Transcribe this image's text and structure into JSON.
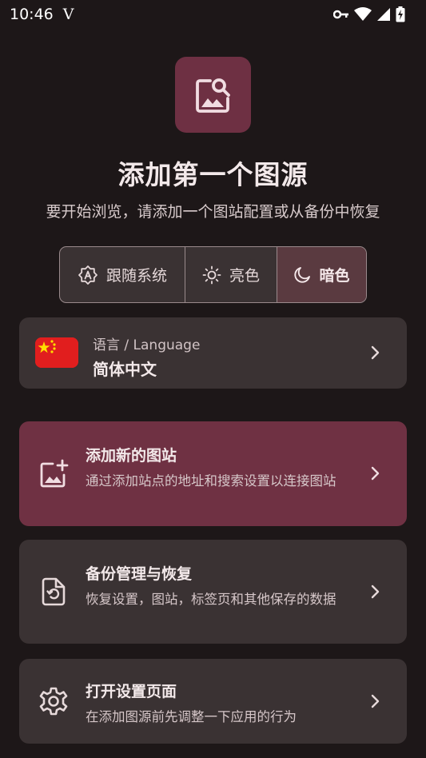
{
  "status_bar": {
    "time": "10:46",
    "notification_glyph": "V",
    "icons": [
      "vpn-key-icon",
      "wifi-icon",
      "signal-icon",
      "battery-charging-icon"
    ]
  },
  "header": {
    "icon": "image-search-icon",
    "title": "添加第一个图源",
    "subtitle": "要开始浏览，请添加一个图站配置或从备份中恢复"
  },
  "theme_selector": {
    "options": [
      {
        "label": "跟随系统",
        "icon": "auto-theme-icon",
        "selected": false
      },
      {
        "label": "亮色",
        "icon": "sun-icon",
        "selected": false
      },
      {
        "label": "暗色",
        "icon": "moon-icon",
        "selected": true
      }
    ]
  },
  "language": {
    "label": "语言 / Language",
    "value": "简体中文",
    "flag": "china-flag-icon"
  },
  "actions": [
    {
      "title": "添加新的图站",
      "description": "通过添加站点的地址和搜索设置以连接图站",
      "icon": "add-photo-icon"
    },
    {
      "title": "备份管理与恢复",
      "description": "恢复设置，图站，标签页和其他保存的数据",
      "icon": "restore-file-icon"
    },
    {
      "title": "打开设置页面",
      "description": "在添加图源前先调整一下应用的行为",
      "icon": "gear-icon"
    }
  ],
  "colors": {
    "background": "#1d1718",
    "accent": "#6f3143",
    "card": "#3a3233"
  }
}
